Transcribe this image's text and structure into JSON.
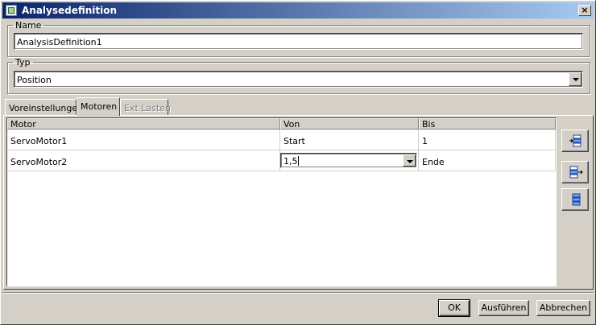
{
  "window": {
    "title": "Analysedefinition",
    "close_label": "×"
  },
  "name_group": {
    "legend": "Name",
    "value": "AnalysisDefinition1"
  },
  "typ_group": {
    "legend": "Typ",
    "selected": "Position"
  },
  "tabs": [
    {
      "label": "Voreinstellungen",
      "state": "normal"
    },
    {
      "label": "Motoren",
      "state": "active"
    },
    {
      "label": "Ext Lasten",
      "state": "disabled"
    }
  ],
  "table": {
    "columns": [
      "Motor",
      "Von",
      "Bis"
    ],
    "rows": [
      {
        "motor": "ServoMotor1",
        "von": "Start",
        "bis": "1"
      },
      {
        "motor": "ServoMotor2",
        "von": "1,5",
        "bis": "Ende"
      }
    ]
  },
  "side_buttons": [
    {
      "icon": "insert-row-before-icon"
    },
    {
      "icon": "insert-row-after-icon"
    },
    {
      "icon": "fill-rows-icon"
    }
  ],
  "footer": {
    "ok_label": "OK",
    "run_label": "Ausführen",
    "cancel_label": "Abbrechen"
  }
}
